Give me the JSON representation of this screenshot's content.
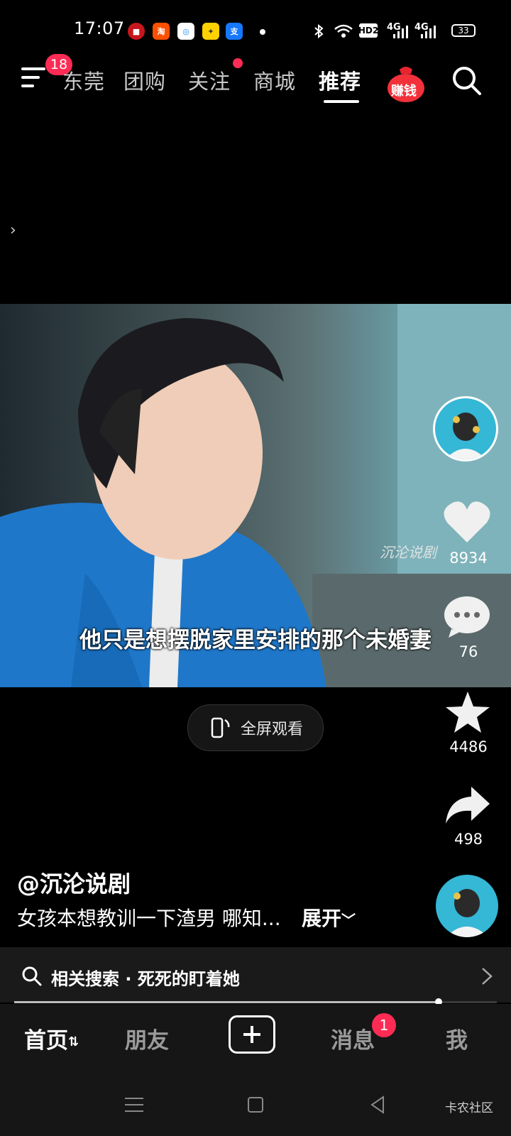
{
  "status_bar": {
    "time": "17:07",
    "network_hd": "HD2",
    "signal_1": "4G",
    "signal_2": "4G",
    "battery": "33"
  },
  "top_nav": {
    "menu_badge": "18",
    "tabs": [
      "东莞",
      "团购",
      "关注",
      "商城",
      "推荐"
    ],
    "active_tab": "推荐",
    "earn_label": "赚钱"
  },
  "video": {
    "watermark": "沉沦说剧",
    "subtitle": "他只是想摆脱家里安排的那个未婚妻",
    "fullscreen_label": "全屏观看"
  },
  "rail": {
    "likes": "8934",
    "comments": "76",
    "favorites": "4486",
    "shares": "498"
  },
  "caption": {
    "author": "@沉沦说剧",
    "description": "女孩本想教训一下渣男 哪知...",
    "expand": "展开"
  },
  "related": {
    "text": "相关搜索 · 死死的盯着她",
    "progress": 0.88
  },
  "bottom_tabs": {
    "home": "首页",
    "friends": "朋友",
    "messages": "消息",
    "message_badge": "1",
    "me": "我"
  },
  "footer_mark": "卡农社区",
  "colors": {
    "accent": "#fe2c55",
    "background": "#000000"
  }
}
